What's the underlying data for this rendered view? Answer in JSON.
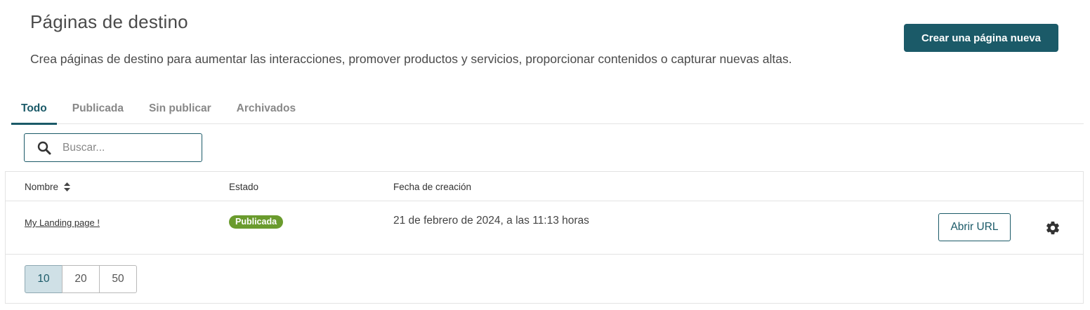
{
  "header": {
    "title": "Páginas de destino",
    "description": "Crea páginas de destino para aumentar las interacciones, promover productos y servicios, proporcionar contenidos o capturar nuevas altas.",
    "create_button": "Crear una página nueva"
  },
  "tabs": [
    {
      "label": "Todo",
      "active": true
    },
    {
      "label": "Publicada",
      "active": false
    },
    {
      "label": "Sin publicar",
      "active": false
    },
    {
      "label": "Archivados",
      "active": false
    }
  ],
  "search": {
    "placeholder": "Buscar...",
    "value": "",
    "icon": "search-icon"
  },
  "table": {
    "columns": {
      "name": "Nombre",
      "status": "Estado",
      "created": "Fecha de creación"
    },
    "rows": [
      {
        "name": "My Landing page !",
        "status": "Publicada",
        "created": "21 de febrero de 2024, a las 11:13 horas",
        "open_url": "Abrir URL",
        "settings_icon": "gear-icon"
      }
    ]
  },
  "pagination": {
    "options": [
      "10",
      "20",
      "50"
    ],
    "selected": "10"
  },
  "colors": {
    "primary": "#1b5a68",
    "badge_published": "#6a9b2d",
    "page_size_selected_bg": "#cfe0e6"
  }
}
